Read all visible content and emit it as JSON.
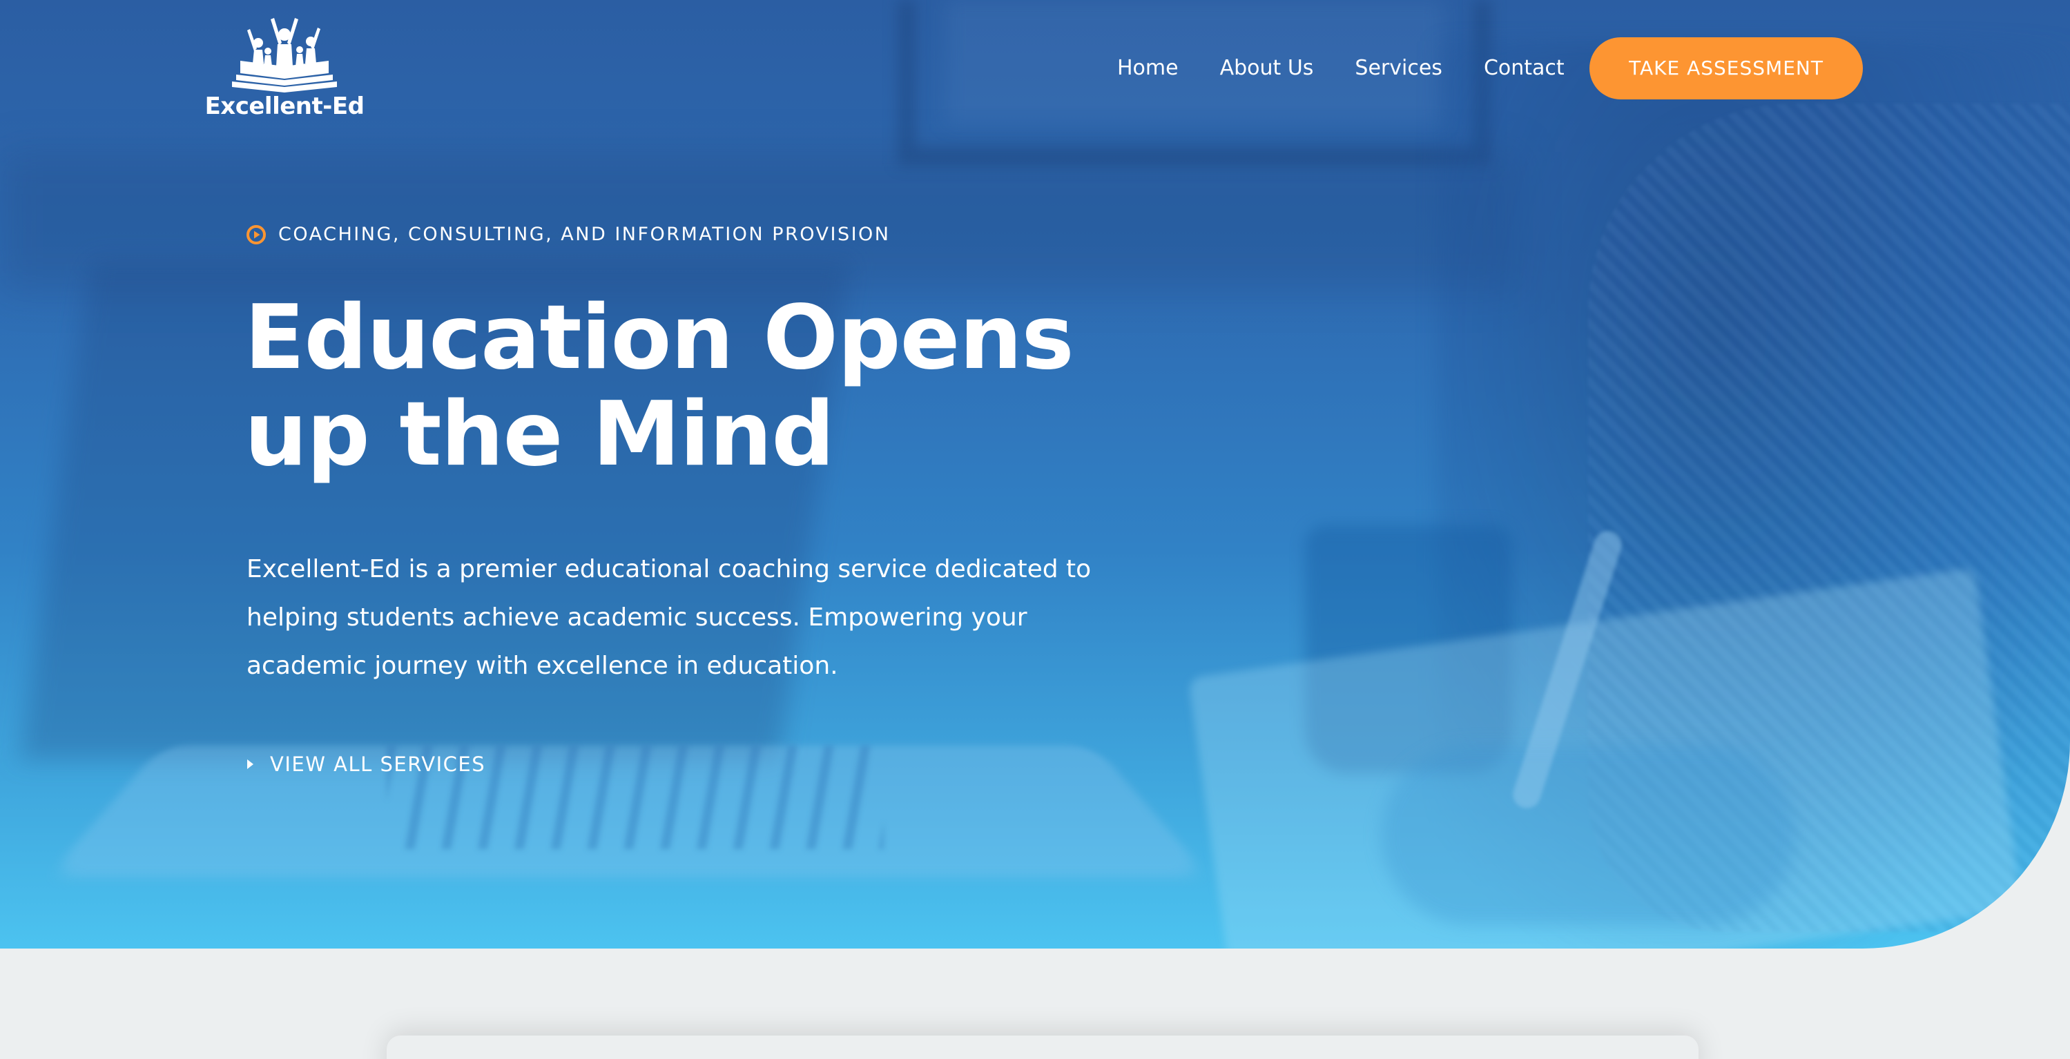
{
  "brand": {
    "name": "Excellent-Ed",
    "logo_icon": "book-with-students-icon"
  },
  "nav": {
    "items": [
      {
        "label": "Home"
      },
      {
        "label": "About Us"
      },
      {
        "label": "Services"
      },
      {
        "label": "Contact"
      }
    ],
    "cta_label": "TAKE ASSESSMENT"
  },
  "hero": {
    "eyebrow": "COACHING, CONSULTING, AND INFORMATION PROVISION",
    "eyebrow_icon": "play-circle-icon",
    "headline_line1": "Education Opens",
    "headline_line2": "up the Mind",
    "lead": "Excellent-Ed is a premier educational coaching service dedicated to helping students achieve academic success. Empowering your academic journey with excellence in education.",
    "link_label": "VIEW ALL SERVICES",
    "link_icon": "caret-right-icon"
  },
  "colors": {
    "accent": "#fd9532",
    "hero_top": "#2b5ea3",
    "hero_bottom": "#4cc3f0",
    "page_bg": "#eceff0",
    "text": "#ffffff"
  }
}
